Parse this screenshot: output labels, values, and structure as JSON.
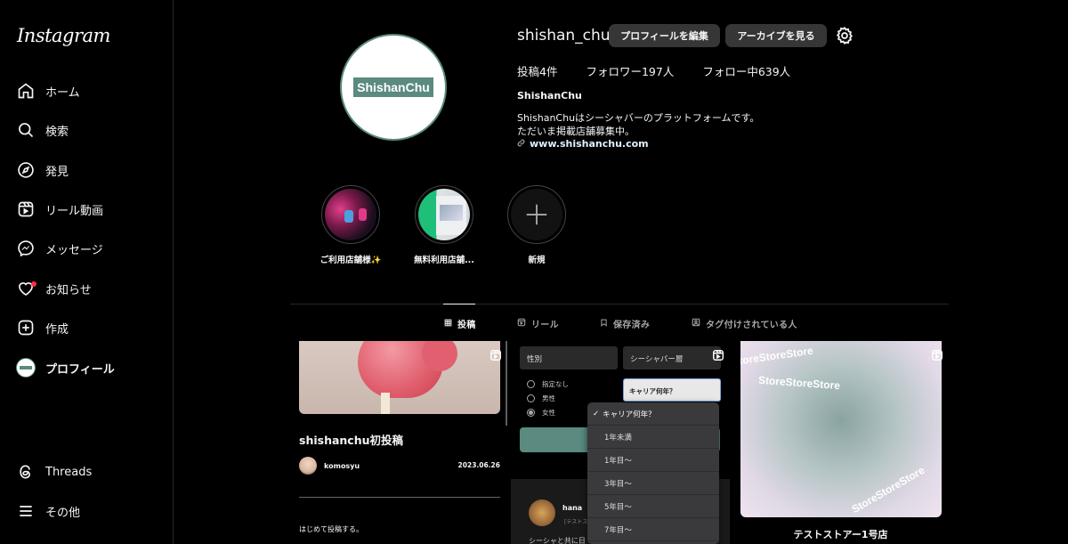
{
  "app": {
    "logo": "Instagram"
  },
  "sidebar": {
    "items": [
      {
        "label": "ホーム",
        "icon": "home-icon"
      },
      {
        "label": "検索",
        "icon": "search-icon"
      },
      {
        "label": "発見",
        "icon": "compass-icon"
      },
      {
        "label": "リール動画",
        "icon": "reels-icon"
      },
      {
        "label": "メッセージ",
        "icon": "messenger-icon"
      },
      {
        "label": "お知らせ",
        "icon": "heart-icon"
      },
      {
        "label": "作成",
        "icon": "create-icon"
      },
      {
        "label": "プロフィール",
        "icon": "avatar"
      }
    ],
    "bottom": [
      {
        "label": "Threads",
        "icon": "threads-icon"
      },
      {
        "label": "その他",
        "icon": "menu-icon"
      }
    ]
  },
  "profile": {
    "username": "shishan_chu",
    "edit_button": "プロフィールを編集",
    "archive_button": "アーカイブを見る",
    "avatar_text": "ShishanChu",
    "stats": {
      "posts": "投稿4件",
      "followers": "フォロワー197人",
      "following": "フォロー中639人"
    },
    "display_name": "ShishanChu",
    "bio_line1": "ShishanChuはシーシャバーのプラットフォームです。",
    "bio_line2": "ただいま掲載店舗募集中。",
    "link": "www.shishanchu.com"
  },
  "highlights": [
    {
      "caption": "ご利用店舗様✨"
    },
    {
      "caption": "無料利用店舗..."
    },
    {
      "caption": "新規"
    }
  ],
  "tabs": [
    {
      "label": "投稿",
      "icon": "grid-icon",
      "active": true
    },
    {
      "label": "リール",
      "icon": "reels-icon",
      "active": false
    },
    {
      "label": "保存済み",
      "icon": "bookmark-icon",
      "active": false
    },
    {
      "label": "タグ付けされている人",
      "icon": "tag-icon",
      "active": false
    }
  ],
  "posts": {
    "post1": {
      "title": "shishanchu初投稿",
      "author": "komosyu",
      "date": "2023.06.26",
      "text": "はじめて投稿する。"
    },
    "post2": {
      "gender_label": "性別",
      "bar_label": "シーシャバー層",
      "options": [
        "指定なし",
        "男性",
        "女性"
      ],
      "career_select": "キャリア何年？",
      "hana": "hana",
      "hana_sub": "[テストス",
      "hana_text": "シーシャと共に日",
      "dropdown": [
        "キャリア何年？",
        "1年未満",
        "1年目〜",
        "3年目〜",
        "5年目〜",
        "7年目〜"
      ]
    },
    "post3": {
      "title": "テストストアー1号店",
      "wave_text": "StoreStoreStore"
    }
  },
  "colors": {
    "accent": "#5a8a80",
    "notification": "#ff3040"
  }
}
